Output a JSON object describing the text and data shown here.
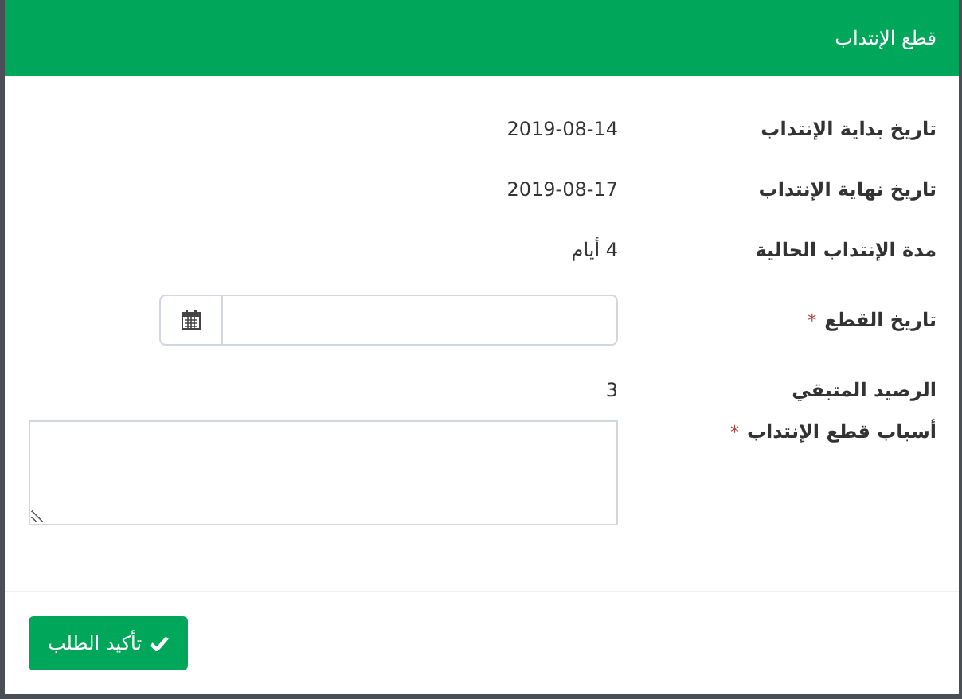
{
  "dialog": {
    "title": "قطع الإنتداب"
  },
  "fields": [
    {
      "kind": "text",
      "label": "تاريخ بداية الإنتداب",
      "value": "2019-08-14"
    },
    {
      "kind": "text",
      "label": "تاريخ نهاية الإنتداب",
      "value": "2019-08-17"
    },
    {
      "kind": "text",
      "label": "مدة الإنتداب الحالية",
      "value": "4 أيام"
    },
    {
      "kind": "date",
      "label": "تاريخ القطع",
      "required_marker": "*"
    },
    {
      "kind": "text",
      "label": "الرصيد المتبقي",
      "value": "3"
    },
    {
      "kind": "textarea",
      "label": "أسباب قطع الإنتداب",
      "required_marker": "*"
    }
  ],
  "submit_button": {
    "label": "تأكيد الطلب"
  }
}
